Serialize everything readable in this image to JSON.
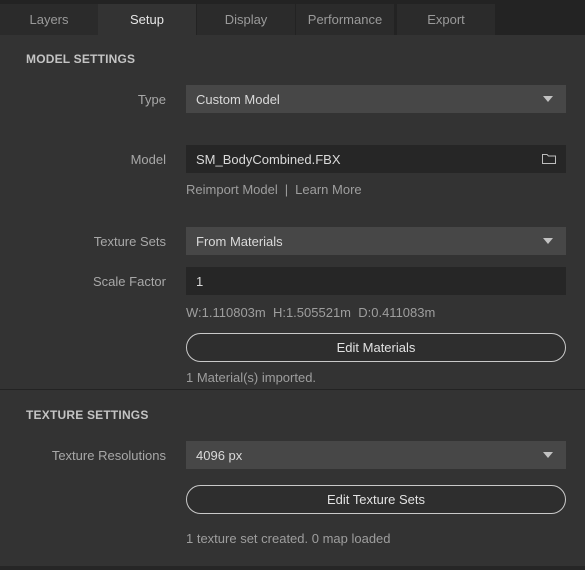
{
  "tabs": [
    {
      "label": "Layers"
    },
    {
      "label": "Setup"
    },
    {
      "label": "Display"
    },
    {
      "label": "Performance"
    },
    {
      "label": "Export"
    }
  ],
  "active_tab": "Setup",
  "model_settings": {
    "title": "MODEL SETTINGS",
    "type": {
      "label": "Type",
      "value": "Custom Model"
    },
    "model": {
      "label": "Model",
      "value": "SM_BodyCombined.FBX",
      "icon": "folder-icon"
    },
    "reimport_link": "Reimport Model",
    "link_separator": "|",
    "learn_more_link": "Learn More",
    "texture_sets": {
      "label": "Texture Sets",
      "value": "From Materials"
    },
    "scale_factor": {
      "label": "Scale Factor",
      "value": "1"
    },
    "dimensions": "W:1.110803m  H:1.505521m  D:0.411083m",
    "edit_materials_button": "Edit Materials",
    "materials_status": "1 Material(s) imported."
  },
  "texture_settings": {
    "title": "TEXTURE SETTINGS",
    "resolution": {
      "label": "Texture Resolutions",
      "value": "4096 px"
    },
    "edit_texture_sets_button": "Edit Texture Sets",
    "status": "1 texture set created. 0 map loaded"
  },
  "colors": {
    "background": "#333333",
    "tab_bar": "#232323",
    "select_bg": "#474747",
    "input_bg": "#262626"
  }
}
